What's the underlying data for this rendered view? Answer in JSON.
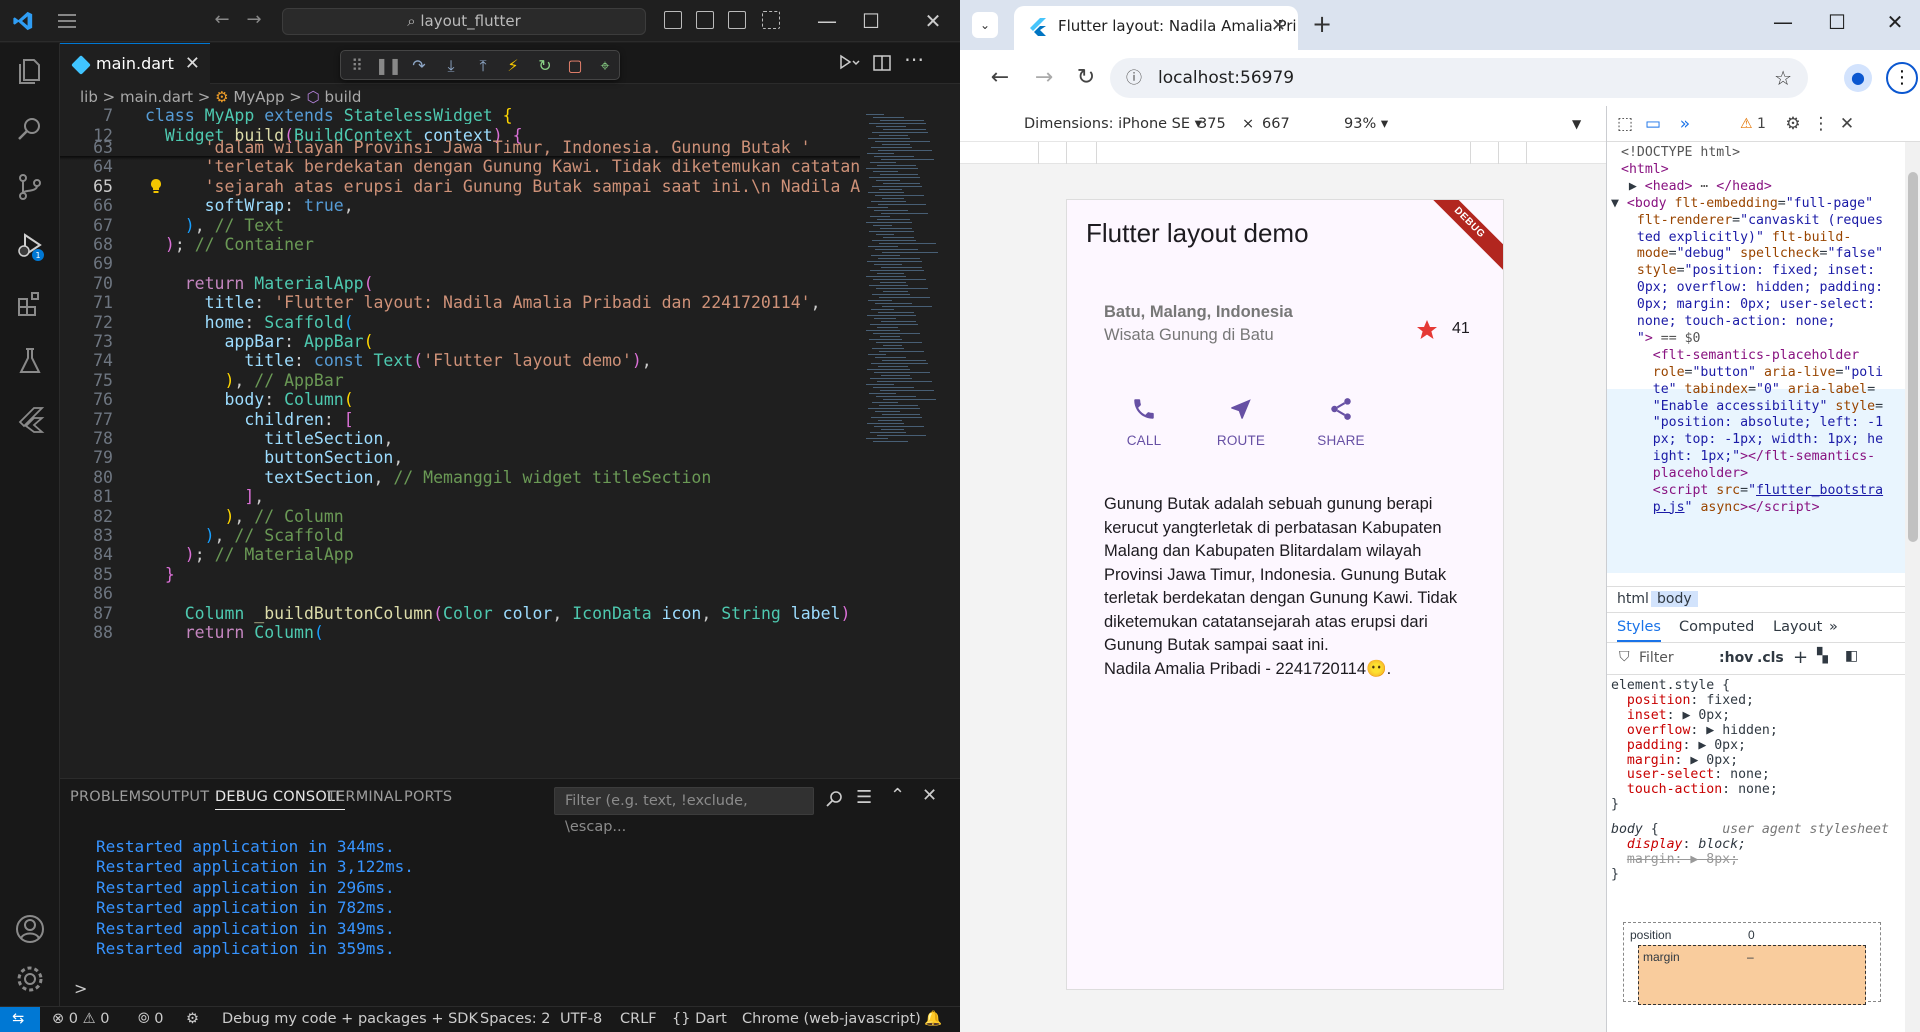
{
  "vscode": {
    "search_text": "layout_flutter",
    "tab": {
      "file": "main.dart",
      "close": "✕"
    },
    "breadcrumb": {
      "folder": "lib",
      "sep": ">",
      "file": "main.dart",
      "class": "MyApp",
      "method": "build"
    },
    "sticky_lines": [
      {
        "num": "7",
        "html": "<span class='k'>class</span> <span class='t'>MyApp</span> <span class='k'>extends</span> <span class='t'>StatelessWidget</span> <span class='b1'>{</span>"
      },
      {
        "num": "12",
        "html": "  <span class='t'>Widget</span> <span class='f'>build</span><span class='b2'>(</span><span class='t'>BuildContext</span> <span class='v'>context</span><span class='b2'>)</span> <span class='b2'>{</span>"
      }
    ],
    "code_lines": [
      {
        "num": "63",
        "html": "      <span class='s'>'dalam wilayah Provinsi Jawa Timur, Indonesia. Gunung Butak '</span>"
      },
      {
        "num": "64",
        "html": "      <span class='s'>'terletak berdekatan dengan Gunung Kawi. Tidak diketemukan catatan'</span>"
      },
      {
        "num": "65",
        "html": "      <span class='s'>'sejarah atas erupsi dari Gunung Butak sampai saat ini.\\n Nadila Ama</span>",
        "current": true
      },
      {
        "num": "66",
        "html": "      <span class='v'>softWrap</span><span class='p'>:</span> <span class='k'>true</span><span class='p'>,</span>"
      },
      {
        "num": "67",
        "html": "    <span class='b3'>)</span><span class='p'>,</span> <span class='c'>// Text</span>"
      },
      {
        "num": "68",
        "html": "  <span class='b2'>)</span><span class='p'>;</span> <span class='c'>// Container</span>"
      },
      {
        "num": "69",
        "html": ""
      },
      {
        "num": "70",
        "html": "    <span class='kc'>return</span> <span class='t'>MaterialApp</span><span class='b2'>(</span>"
      },
      {
        "num": "71",
        "html": "      <span class='v'>title</span><span class='p'>:</span> <span class='s'>'Flutter layout: Nadila Amalia Pribadi dan 2241720114'</span><span class='p'>,</span>"
      },
      {
        "num": "72",
        "html": "      <span class='v'>home</span><span class='p'>:</span> <span class='t'>Scaffold</span><span class='b3'>(</span>"
      },
      {
        "num": "73",
        "html": "        <span class='v'>appBar</span><span class='p'>:</span> <span class='t'>AppBar</span><span class='b1'>(</span>"
      },
      {
        "num": "74",
        "html": "          <span class='v'>title</span><span class='p'>:</span> <span class='k'>const</span> <span class='t'>Text</span><span class='b2'>(</span><span class='s'>'Flutter layout demo'</span><span class='b2'>)</span><span class='p'>,</span>"
      },
      {
        "num": "75",
        "html": "        <span class='b1'>)</span><span class='p'>,</span> <span class='c'>// AppBar</span>"
      },
      {
        "num": "76",
        "html": "        <span class='v'>body</span><span class='p'>:</span> <span class='t'>Column</span><span class='b1'>(</span>"
      },
      {
        "num": "77",
        "html": "          <span class='v'>children</span><span class='p'>:</span> <span class='b2'>[</span>"
      },
      {
        "num": "78",
        "html": "            <span class='v'>titleSection</span><span class='p'>,</span>"
      },
      {
        "num": "79",
        "html": "            <span class='v'>buttonSection</span><span class='p'>,</span>"
      },
      {
        "num": "80",
        "html": "            <span class='v'>textSection</span><span class='p'>,</span> <span class='c'>// Memanggil widget titleSection</span>"
      },
      {
        "num": "81",
        "html": "          <span class='b2'>]</span><span class='p'>,</span>"
      },
      {
        "num": "82",
        "html": "        <span class='b1'>)</span><span class='p'>,</span> <span class='c'>// Column</span>"
      },
      {
        "num": "83",
        "html": "      <span class='b3'>)</span><span class='p'>,</span> <span class='c'>// Scaffold</span>"
      },
      {
        "num": "84",
        "html": "    <span class='b2'>)</span><span class='p'>;</span> <span class='c'>// MaterialApp</span>"
      },
      {
        "num": "85",
        "html": "  <span class='b2'>}</span>"
      },
      {
        "num": "86",
        "html": ""
      },
      {
        "num": "87",
        "html": "    <span class='t'>Column</span> <span class='f'>_buildButtonColumn</span><span class='b2'>(</span><span class='t'>Color</span> <span class='v'>color</span><span class='p'>,</span> <span class='t'>IconData</span> <span class='v'>icon</span><span class='p'>,</span> <span class='t'>String</span> <span class='v'>label</span><span class='b2'>)</span> <span class='b2'>{</span>"
      },
      {
        "num": "88",
        "html": "    <span class='kc'>return</span> <span class='t'>Column</span><span class='b3'>(</span>"
      }
    ],
    "panel": {
      "tabs": [
        "PROBLEMS",
        "OUTPUT",
        "DEBUG CONSOLE",
        "TERMINAL",
        "PORTS"
      ],
      "filter_placeholder": "Filter (e.g. text, !exclude, \\escap...",
      "console_lines": [
        "Restarted application in 344ms.",
        "Restarted application in 3,122ms.",
        "Restarted application in 296ms.",
        "Restarted application in 782ms.",
        "Restarted application in 349ms.",
        "Restarted application in 359ms."
      ],
      "prompt": ">"
    },
    "status": {
      "errors": "0",
      "warnings": "0",
      "ports": "0",
      "debug": "Debug my code + packages + SDK",
      "spaces": "Spaces: 2",
      "encoding": "UTF-8",
      "eol": "CRLF",
      "language": "Dart",
      "device": "Chrome (web-javascript)"
    }
  },
  "chrome": {
    "tab_title": "Flutter layout: Nadila Amalia Pri",
    "url": "localhost:56979",
    "device": {
      "dimensions": "Dimensions: iPhone SE",
      "width": "375",
      "x": "×",
      "height": "667",
      "zoom": "93%"
    },
    "app": {
      "title": "Flutter layout demo",
      "debug_banner": "DEBUG",
      "location_name": "Batu, Malang, Indonesia",
      "location_sub": "Wisata Gunung di Batu",
      "star_count": "41",
      "buttons": [
        "CALL",
        "ROUTE",
        "SHARE"
      ],
      "description": "Gunung Butak adalah sebuah gunung berapi kerucut yangterletak di perbatasan Kabupaten Malang dan Kabupaten Blitardalam wilayah Provinsi Jawa Timur, Indonesia. Gunung Butak terletak berdekatan dengan Gunung Kawi. Tidak diketemukan catatansejarah atas erupsi dari Gunung Butak sampai saat ini.",
      "author_line": " Nadila Amalia Pribadi - 2241720114😶."
    },
    "devtools": {
      "issues_count": "1",
      "dom_lines": [
        "<span class='dtext'>&lt;!DOCTYPE html&gt;</span>",
        "<span class='tag'>&lt;html&gt;</span>",
        "  ▶ <span class='tag'>&lt;head&gt;</span> <span class='dtext'>⋯</span> <span class='tag'>&lt;/head&gt;</span>",
        "▼ <span class='tag'>&lt;body</span> <span class='attr'>flt-embedding</span>=<span class='aval'>\"full-page\"</span>",
        "  <span class='attr'>flt-renderer</span>=<span class='aval'>\"canvaskit (reques</span>",
        "  <span class='aval'>ted explicitly)\"</span> <span class='attr'>flt-build-</span>",
        "  <span class='attr'>mode</span>=<span class='aval'>\"debug\"</span> <span class='attr'>spellcheck</span>=<span class='aval'>\"false\"</span>",
        "  <span class='attr'>style</span>=<span class='aval'>\"position: fixed; inset:</span>",
        "  <span class='aval'>0px; overflow: hidden; padding:</span>",
        "  <span class='aval'>0px; margin: 0px; user-select:</span>",
        "  <span class='aval'>none; touch-action: none;</span>",
        "  <span class='aval'>\"</span><span class='tag'>&gt;</span> <span class='dtext'>== $0</span>",
        "    <span class='tag'>&lt;flt-semantics-placeholder</span>",
        "    <span class='attr'>role</span>=<span class='aval'>\"button\"</span> <span class='attr'>aria-live</span>=<span class='aval'>\"poli</span>",
        "    <span class='aval'>te\"</span> <span class='attr'>tabindex</span>=<span class='aval'>\"0\"</span> <span class='attr'>aria-label</span>=",
        "    <span class='aval'>\"Enable accessibility\"</span> <span class='attr'>style</span>=",
        "    <span class='aval'>\"position: absolute; left: -1</span>",
        "    <span class='aval'>px; top: -1px; width: 1px; he</span>",
        "    <span class='aval'>ight: 1px;\"</span><span class='tag'>&gt;&lt;/flt-semantics-</span>",
        "    <span class='tag'>placeholder&gt;</span>",
        "    <span class='tag'>&lt;script</span> <span class='attr'>src</span>=<span class='aval'>\"</span><span class='link'>flutter_bootstra</span>",
        "    <span class='link'>p.js</span><span class='aval'>\"</span> <span class='attr'>async</span><span class='tag'>&gt;&lt;/script&gt;</span>"
      ],
      "crumbs": [
        "html",
        "body"
      ],
      "panel_tabs": [
        "Styles",
        "Computed",
        "Layout",
        "»"
      ],
      "filter_placeholder": "Filter",
      "filter_tools": [
        ":hov",
        ".cls"
      ],
      "style_lines": [
        "<span class='sel'>element.style {</span>",
        "  <span class='prop'>position</span>: <span class='val'>fixed;</span>",
        "  <span class='prop'>inset</span>: ▶ <span class='val'>0px;</span>",
        "  <span class='prop'>overflow</span>: ▶ <span class='val'>hidden;</span>",
        "  <span class='prop'>padding</span>: ▶ <span class='val'>0px;</span>",
        "  <span class='prop'>margin</span>: ▶ <span class='val'>0px;</span>",
        "  <span class='prop'>user-select</span>: <span class='val'>none;</span>",
        "  <span class='prop'>touch-action</span>: <span class='val'>none;</span>",
        "<span class='sel'>}</span>",
        "<span class='sel'><i>body</i> {</span>        <span style='color:#777'><i>user agent stylesheet</i></span>",
        "  <span class='prop'><i>display</i></span>: <i>block;</i>",
        "  <span class='strike'>margin: ▶ 8px;</span>",
        "<span class='sel'>}</span>"
      ],
      "box_model": {
        "position_label": "position",
        "position_value": "0",
        "margin_label": "margin",
        "margin_value": "–"
      }
    }
  }
}
